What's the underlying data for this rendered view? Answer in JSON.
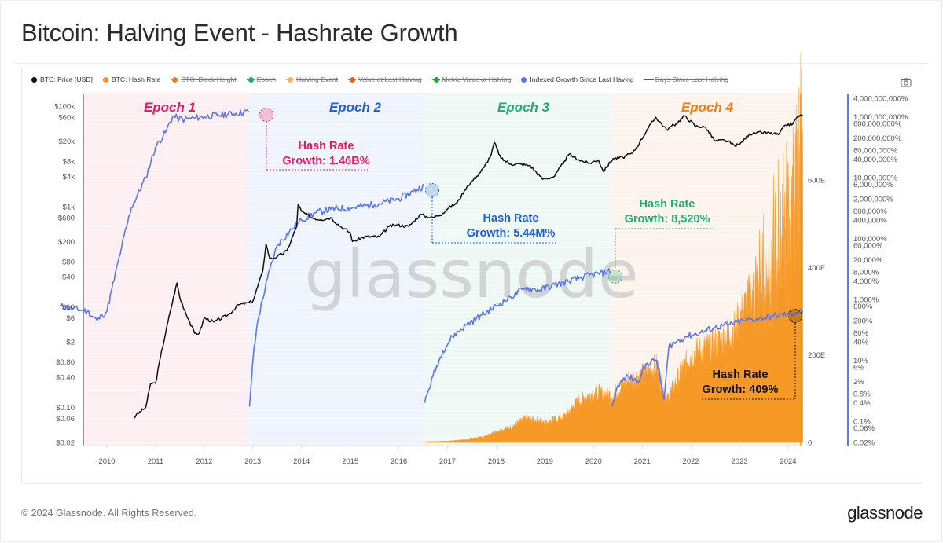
{
  "title": "Bitcoin: Halving Event - Hashrate Growth",
  "legend": [
    {
      "label": "BTC: Price [USD]",
      "color": "#111111",
      "enabled": true,
      "marker": "dot"
    },
    {
      "label": "BTC: Hash Rate",
      "color": "#f7931a",
      "enabled": true,
      "marker": "dot"
    },
    {
      "label": "BTC: Block Height",
      "color": "#f07b16",
      "enabled": false,
      "marker": "line-dot"
    },
    {
      "label": "Epoch",
      "color": "#2aa58a",
      "enabled": false,
      "marker": "line-dot"
    },
    {
      "label": "Halving Event",
      "color": "#f5b36b",
      "enabled": false,
      "marker": "line-dot"
    },
    {
      "label": "Value at Last Halving",
      "color": "#e8641b",
      "enabled": false,
      "marker": "line-dot"
    },
    {
      "label": "Metric Value at Halving",
      "color": "#1fa83b",
      "enabled": false,
      "marker": "line-dot"
    },
    {
      "label": "Indexed Growth Since Last Having",
      "color": "#5b78f0",
      "enabled": true,
      "marker": "dot"
    },
    {
      "label": "Days Since Last Halving",
      "color": "#555555",
      "enabled": false,
      "marker": "dash"
    }
  ],
  "toolbar": {
    "camera_icon": "camera-icon"
  },
  "watermark": "glassnode",
  "footer": {
    "copyright": "© 2024 Glassnode. All Rights Reserved.",
    "logo": "glassnode"
  },
  "chart_data": {
    "type": "line",
    "title": "Bitcoin: Halving Event - Hashrate Growth",
    "x_ticks": [
      "2010",
      "2011",
      "2012",
      "2013",
      "2014",
      "2015",
      "2016",
      "2017",
      "2018",
      "2019",
      "2020",
      "2021",
      "2022",
      "2023",
      "2024"
    ],
    "xlim": [
      2009.0,
      2024.35
    ],
    "y_left": {
      "label": "BTC: Price [USD]",
      "scale": "log",
      "ticks": [
        "$100k",
        "$60k",
        "$20k",
        "$8k",
        "$4k",
        "$1k",
        "$600",
        "$200",
        "$80",
        "$40",
        "$10",
        "$6",
        "$2",
        "$0.80",
        "$0.40",
        "$0.10",
        "$0.06",
        "$0.02"
      ],
      "tick_values": [
        100000,
        60000,
        20000,
        8000,
        4000,
        1000,
        600,
        200,
        80,
        40,
        10,
        6,
        2,
        0.8,
        0.4,
        0.1,
        0.06,
        0.02
      ],
      "range": [
        0.02,
        100000
      ]
    },
    "y_right_hashrate": {
      "label": "BTC: Hash Rate",
      "scale": "linear",
      "ticks": [
        "0",
        "200E",
        "400E",
        "600E"
      ],
      "tick_values": [
        0,
        200,
        400,
        600
      ],
      "range": [
        0,
        805
      ]
    },
    "y_right_growth": {
      "label": "Indexed Growth Since Last Having",
      "scale": "log",
      "ticks": [
        "4,000,000,000%",
        "1,000,000,000%",
        "600,000,000%",
        "200,000,000%",
        "80,000,000%",
        "40,000,000%",
        "10,000,000%",
        "6,000,000%",
        "2,000,000%",
        "800,000%",
        "400,000%",
        "100,000%",
        "60,000%",
        "20,000%",
        "8,000%",
        "4,000%",
        "1,000%",
        "600%",
        "200%",
        "80%",
        "40%",
        "10%",
        "6%",
        "2%",
        "0.8%",
        "0.4%",
        "0.1%",
        "0.06%",
        "0.02%"
      ],
      "tick_values": [
        4000000000,
        1000000000,
        600000000,
        200000000,
        80000000,
        40000000,
        10000000,
        6000000,
        2000000,
        800000,
        400000,
        100000,
        60000,
        20000,
        8000,
        4000,
        1000,
        600,
        200,
        80,
        40,
        10,
        6,
        2,
        0.8,
        0.4,
        0.1,
        0.06,
        0.02
      ],
      "range": [
        0.02,
        4000000000
      ]
    },
    "epochs": [
      {
        "label": "Epoch 1",
        "start": 2009.0,
        "end": 2012.91,
        "color": "#e8185f",
        "bg": "#fdeef1"
      },
      {
        "label": "Epoch 2",
        "start": 2012.91,
        "end": 2016.52,
        "color": "#1f5fe0",
        "bg": "#eef3fd"
      },
      {
        "label": "Epoch 3",
        "start": 2016.52,
        "end": 2020.36,
        "color": "#1fae74",
        "bg": "#eef8f4"
      },
      {
        "label": "Epoch 4",
        "start": 2020.36,
        "end": 2024.3,
        "color": "#f07d0e",
        "bg": "#fdf3ec"
      }
    ],
    "annotations": [
      {
        "line1": "Hash Rate",
        "line2": "Growth: 1.46B%",
        "epoch": 1,
        "value_pct": 1460000000,
        "color": "#e8185f"
      },
      {
        "line1": "Hash Rate",
        "line2": "Growth: 5.44M%",
        "epoch": 2,
        "value_pct": 5440000,
        "color": "#1f5fe0"
      },
      {
        "line1": "Hash Rate",
        "line2": "Growth: 8,520%",
        "epoch": 3,
        "value_pct": 8520,
        "color": "#1fae74"
      },
      {
        "line1": "Hash Rate",
        "line2": "Growth: 409%",
        "epoch": 4,
        "value_pct": 409,
        "color": "#111111"
      }
    ],
    "series": [
      {
        "name": "BTC: Price [USD]",
        "color": "#111111",
        "axis": "left",
        "x": [
          2010.55,
          2010.6,
          2010.8,
          2010.9,
          2011.0,
          2011.1,
          2011.3,
          2011.44,
          2011.5,
          2011.7,
          2011.8,
          2011.9,
          2012.0,
          2012.2,
          2012.5,
          2012.7,
          2012.9,
          2013.0,
          2013.2,
          2013.27,
          2013.35,
          2013.5,
          2013.7,
          2013.9,
          2013.93,
          2014.0,
          2014.2,
          2014.4,
          2014.6,
          2014.8,
          2015.0,
          2015.05,
          2015.3,
          2015.6,
          2015.8,
          2015.95,
          2016.2,
          2016.45,
          2016.52,
          2016.7,
          2016.9,
          2017.0,
          2017.2,
          2017.4,
          2017.6,
          2017.75,
          2017.9,
          2017.96,
          2018.1,
          2018.3,
          2018.5,
          2018.7,
          2018.9,
          2018.96,
          2019.2,
          2019.4,
          2019.5,
          2019.7,
          2019.9,
          2020.1,
          2020.2,
          2020.4,
          2020.6,
          2020.8,
          2020.95,
          2021.1,
          2021.28,
          2021.5,
          2021.7,
          2021.87,
          2022.1,
          2022.3,
          2022.5,
          2022.7,
          2022.9,
          2023.0,
          2023.2,
          2023.5,
          2023.8,
          2023.95,
          2024.1,
          2024.2,
          2024.3
        ],
        "values": [
          0.06,
          0.07,
          0.1,
          0.3,
          0.3,
          1,
          8,
          30,
          15,
          5,
          3,
          3,
          6,
          5,
          7,
          11,
          12,
          13,
          50,
          180,
          90,
          100,
          130,
          400,
          1100,
          800,
          600,
          550,
          600,
          400,
          300,
          200,
          250,
          250,
          400,
          430,
          400,
          700,
          650,
          600,
          730,
          900,
          1200,
          2500,
          4000,
          6000,
          11000,
          19000,
          9000,
          7000,
          7000,
          6500,
          4000,
          3500,
          4000,
          8000,
          11000,
          8500,
          7200,
          8500,
          5000,
          9000,
          9500,
          11500,
          19000,
          34000,
          60000,
          34000,
          45000,
          64000,
          40000,
          38000,
          20000,
          21000,
          16500,
          17000,
          28000,
          30000,
          27000,
          42000,
          45000,
          63000,
          65000
        ]
      },
      {
        "name": "BTC: Hash Rate",
        "color": "#f7931a",
        "axis": "right_hashrate",
        "unit": "EH/s",
        "x": [
          2016.5,
          2017.0,
          2017.5,
          2017.8,
          2018.0,
          2018.3,
          2018.6,
          2018.9,
          2019.0,
          2019.4,
          2019.7,
          2020.0,
          2020.4,
          2020.7,
          2021.0,
          2021.3,
          2021.5,
          2021.8,
          2022.0,
          2022.3,
          2022.6,
          2022.9,
          2023.2,
          2023.5,
          2023.8,
          2024.0,
          2024.2,
          2024.3
        ],
        "values": [
          1.5,
          3,
          8,
          15,
          25,
          35,
          55,
          50,
          45,
          60,
          95,
          115,
          110,
          140,
          155,
          175,
          95,
          160,
          200,
          215,
          230,
          260,
          330,
          380,
          460,
          520,
          600,
          650
        ]
      },
      {
        "name": "Indexed Growth Since Last Having",
        "color": "#5b78f0",
        "axis": "right_growth",
        "x": [
          2009.03,
          2009.3,
          2009.6,
          2009.8,
          2009.9,
          2010.0,
          2010.3,
          2010.5,
          2010.8,
          2011.0,
          2011.2,
          2011.35,
          2011.45,
          2011.6,
          2011.8,
          2012.0,
          2012.3,
          2012.6,
          2012.91,
          2012.93,
          2013.0,
          2013.1,
          2013.3,
          2013.5,
          2013.8,
          2014.0,
          2014.3,
          2014.6,
          2015.0,
          2015.5,
          2016.0,
          2016.3,
          2016.52,
          2016.53,
          2016.7,
          2016.9,
          2017.1,
          2017.4,
          2017.7,
          2018.0,
          2018.3,
          2018.6,
          2018.9,
          2019.2,
          2019.5,
          2019.8,
          2020.1,
          2020.36,
          2020.38,
          2020.5,
          2020.7,
          2020.9,
          2021.1,
          2021.3,
          2021.45,
          2021.55,
          2021.7,
          2021.9,
          2022.2,
          2022.5,
          2022.8,
          2023.1,
          2023.4,
          2023.7,
          2024.0,
          2024.3
        ],
        "values": [
          600,
          500,
          400,
          200,
          300,
          400,
          50000,
          1000000,
          10000000,
          100000000,
          300000000,
          1000000000,
          900000000,
          800000000,
          900000000,
          1000000000,
          1100000000,
          1250000000,
          1460000000,
          0.3,
          10,
          200,
          5000,
          60000,
          200000,
          400000,
          700000,
          900000,
          1000000,
          1300000,
          2000000,
          3500000,
          5440000,
          0.4,
          3,
          20,
          60,
          150,
          300,
          600,
          1200,
          2400,
          2000,
          3000,
          4000,
          5500,
          7000,
          8520,
          0.3,
          1.5,
          3,
          2,
          8,
          10,
          0.5,
          30,
          40,
          60,
          80,
          120,
          150,
          200,
          230,
          280,
          330,
          409
        ]
      }
    ]
  }
}
